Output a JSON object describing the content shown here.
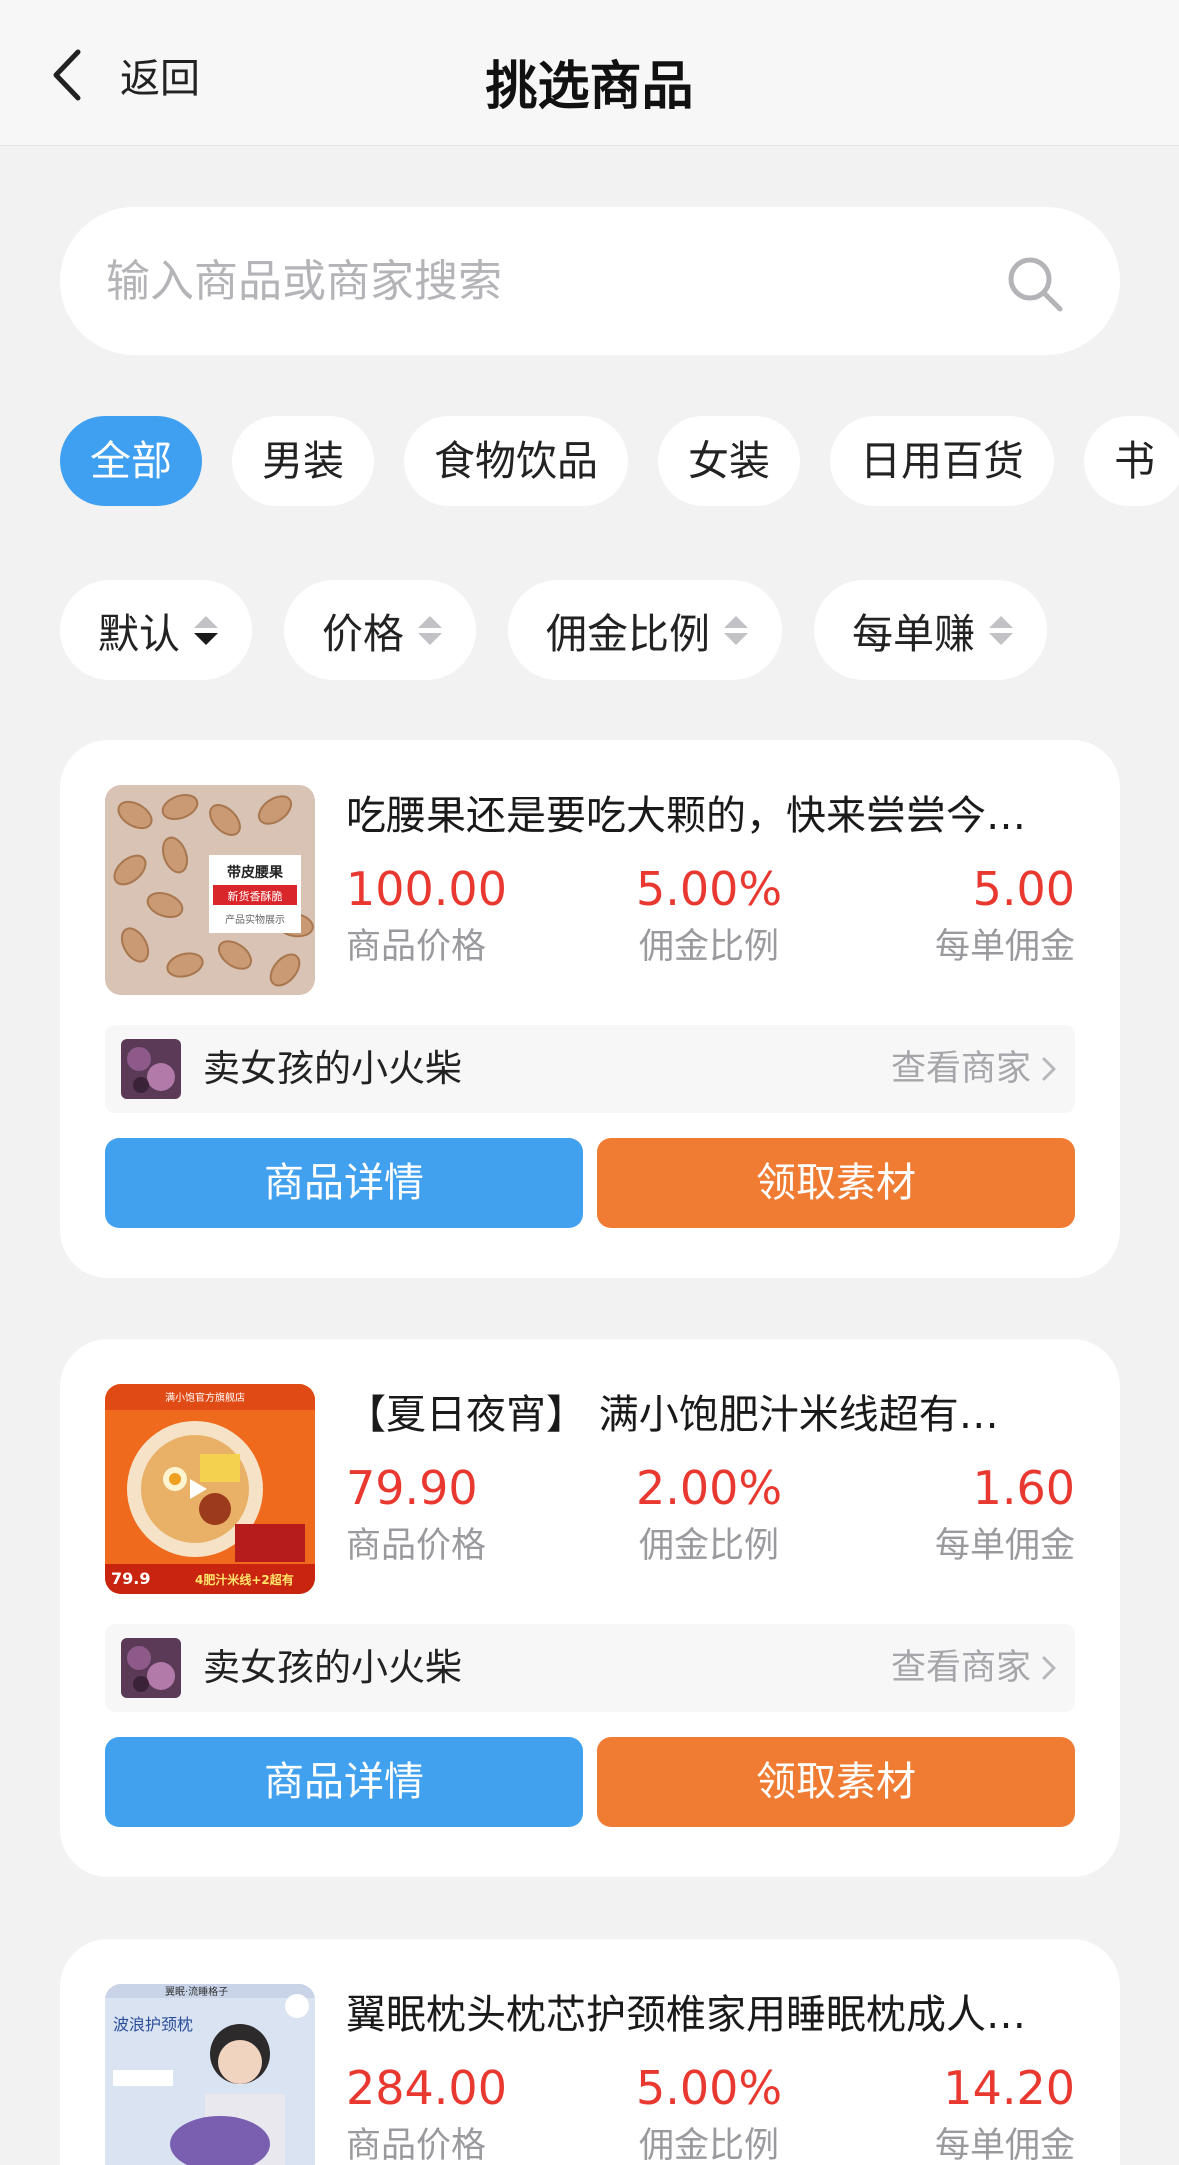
{
  "navbar": {
    "back_label": "返回",
    "title": "挑选商品"
  },
  "search": {
    "placeholder": "输入商品或商家搜索"
  },
  "categories": [
    "全部",
    "男装",
    "食物饮品",
    "女装",
    "日用百货",
    "书"
  ],
  "sorts": [
    "默认",
    "价格",
    "佣金比例",
    "每单赚"
  ],
  "labels": {
    "price": "商品价格",
    "rate": "佣金比例",
    "commission": "每单佣金",
    "view_merchant": "查看商家",
    "detail_button": "商品详情",
    "material_button": "领取素材"
  },
  "products": [
    {
      "title": "吃腰果还是要吃大颗的，快来尝尝今…",
      "price": "100.00",
      "rate": "5.00%",
      "commission": "5.00",
      "merchant": "卖女孩的小火柴",
      "thumb_text": [
        "带皮腰果",
        "新货香酥脆",
        "产品实物展示"
      ]
    },
    {
      "title": "【夏日夜宵】 满小饱肥汁米线超有…",
      "price": "79.90",
      "rate": "2.00%",
      "commission": "1.60",
      "merchant": "卖女孩的小火柴",
      "thumb_text": [
        "满小饱官方旗舰店",
        "4肥汁米线+2超有",
        "79.9"
      ]
    },
    {
      "title": "翼眠枕头枕芯护颈椎家用睡眠枕成人…",
      "price": "284.00",
      "rate": "5.00%",
      "commission": "14.20",
      "merchant": "",
      "thumb_text": [
        "翼眠·流睡格子",
        "波浪护颈枕"
      ]
    }
  ],
  "colors": {
    "accent_blue": "#42a1ee",
    "accent_orange": "#f07c33",
    "price_red": "#e8382f"
  }
}
